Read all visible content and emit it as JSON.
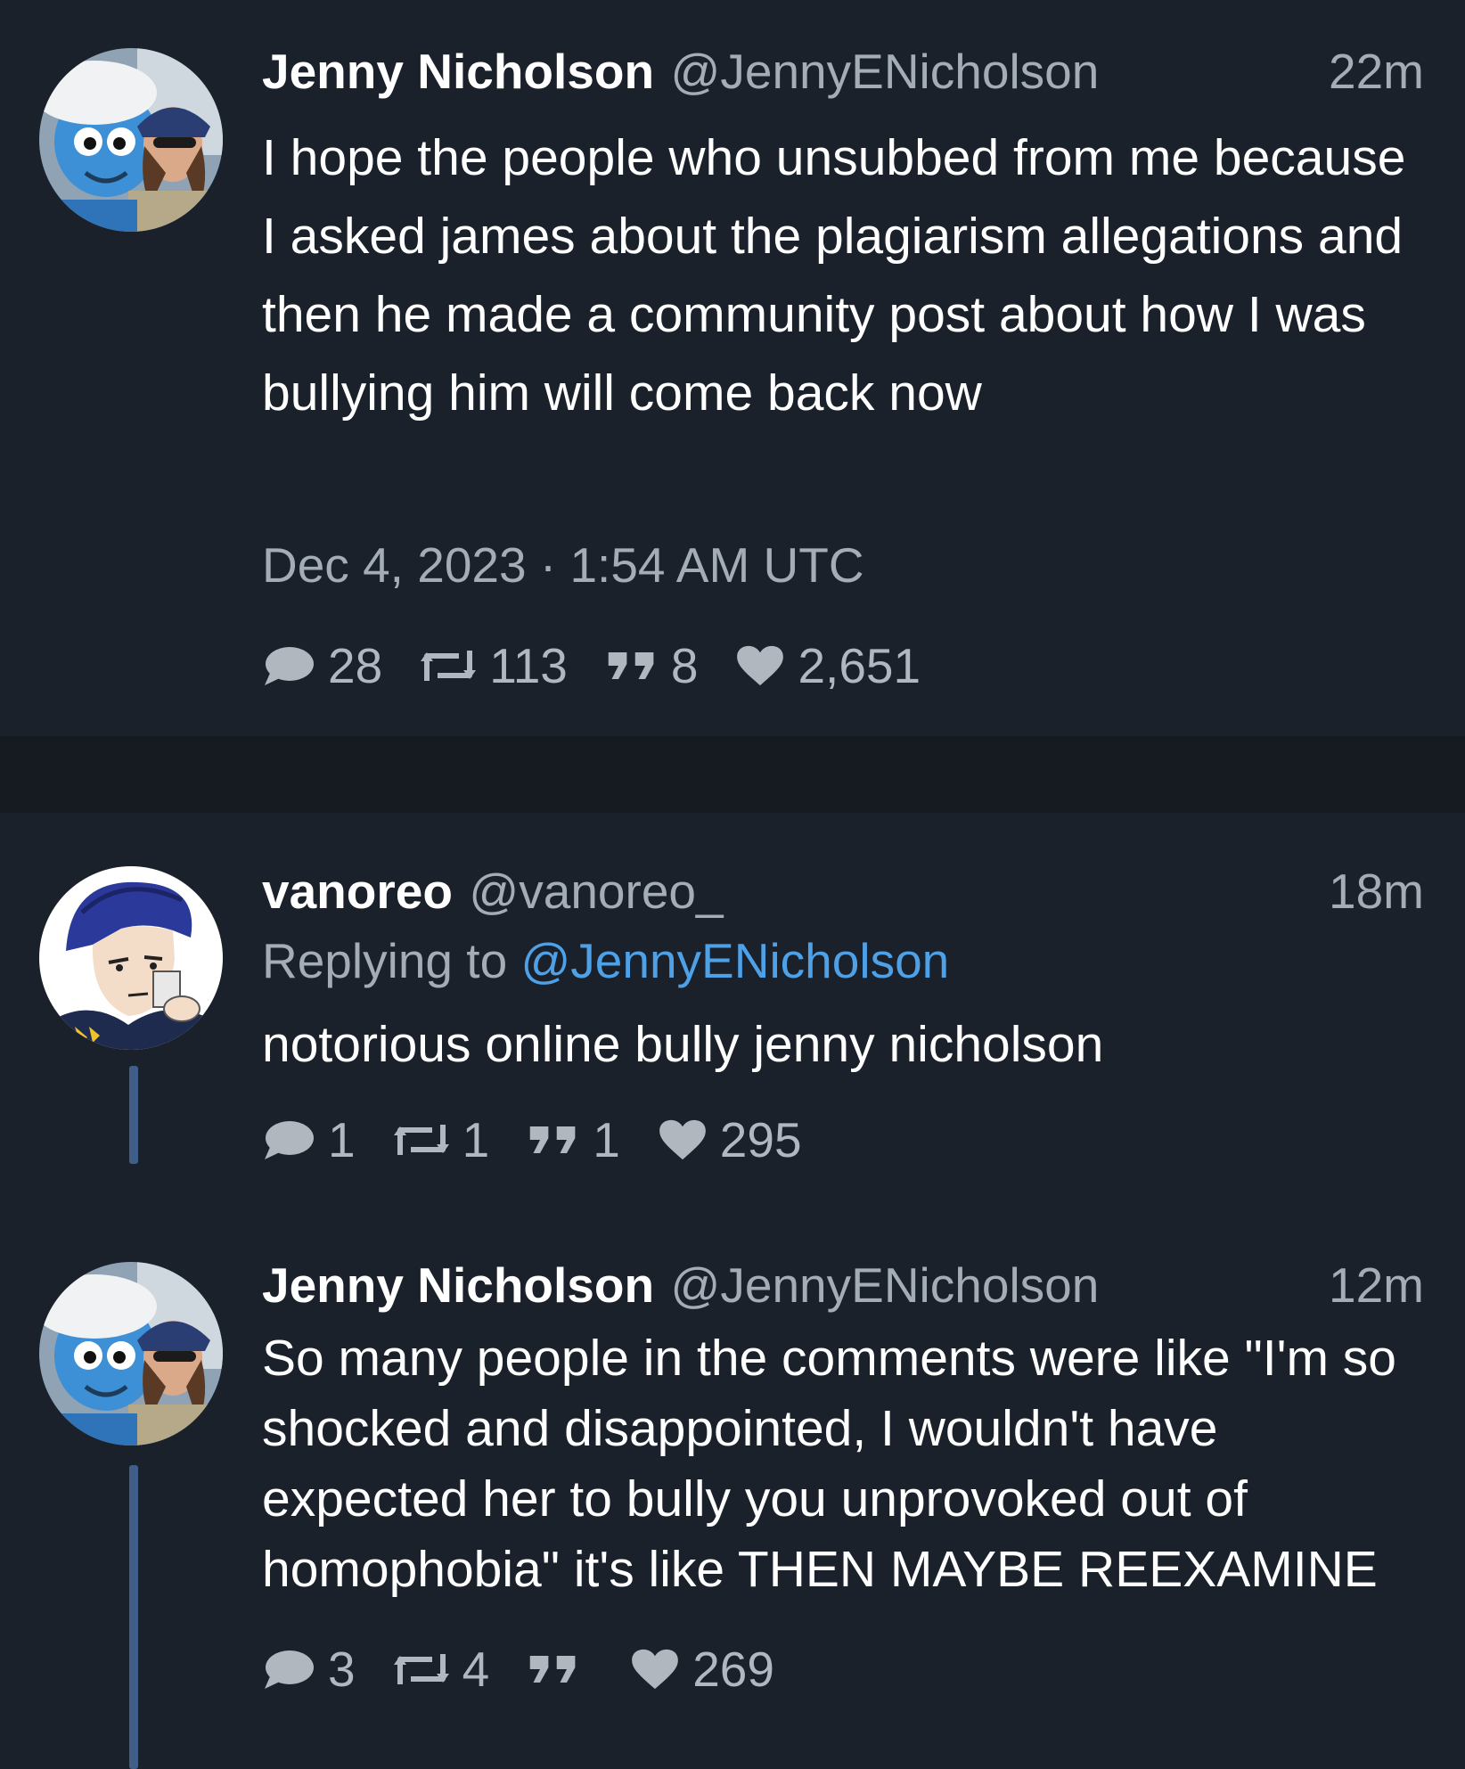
{
  "tweets": [
    {
      "name": "Jenny Nicholson",
      "handle": "@JennyENicholson",
      "time": "22m",
      "text": "I hope the people who unsubbed from me because I asked james about the plagiarism allegations and then he made a community post about how I was bullying him will come back now",
      "date": "Dec 4, 2023 · 1:54 AM UTC",
      "stats": {
        "comments": "28",
        "retweets": "113",
        "quotes": "8",
        "likes": "2,651"
      }
    },
    {
      "name": "vanoreo",
      "handle": "@vanoreo_",
      "time": "18m",
      "replying_prefix": "Replying to",
      "replying_to": "@JennyENicholson",
      "text": "notorious online bully jenny nicholson",
      "stats": {
        "comments": "1",
        "retweets": "1",
        "quotes": "1",
        "likes": "295"
      }
    },
    {
      "name": "Jenny Nicholson",
      "handle": "@JennyENicholson",
      "time": "12m",
      "text": "So many people in the comments were like \"I'm so shocked and disappointed, I wouldn't have expected her to bully you unprovoked out of homophobia\" it's like THEN MAYBE REEXAMINE",
      "stats": {
        "comments": "3",
        "retweets": "4",
        "quotes": "",
        "likes": "269"
      }
    }
  ],
  "colors": {
    "background": "#161b22",
    "card": "#1a212b",
    "muted_text": "#a4acb5",
    "link": "#4ea1e6",
    "thread_line": "#3f5f88"
  },
  "icons": {
    "comment": "comment-icon",
    "retweet": "retweet-icon",
    "quote": "quote-icon",
    "like": "heart-icon"
  }
}
